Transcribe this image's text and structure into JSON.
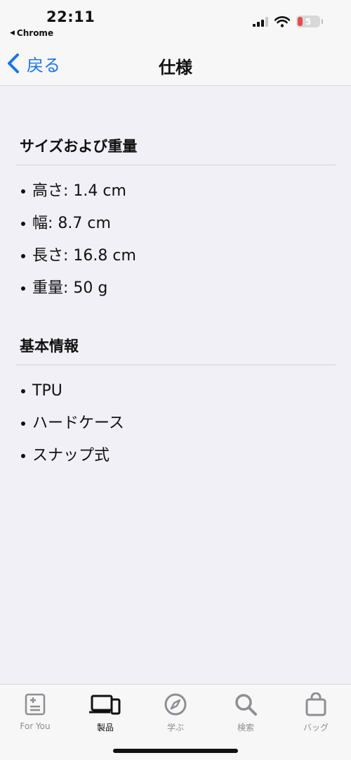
{
  "status": {
    "time": "22:11",
    "back_app": "Chrome",
    "battery": "5"
  },
  "nav": {
    "back_label": "戻る",
    "title": "仕様"
  },
  "sections": [
    {
      "title": "サイズおよび重量",
      "items": [
        "高さ: 1.4 cm",
        "幅: 8.7 cm",
        "長さ: 16.8 cm",
        "重量: 50 g"
      ]
    },
    {
      "title": "基本情報",
      "items": [
        "TPU",
        "ハードケース",
        "スナップ式"
      ]
    }
  ],
  "tabs": [
    {
      "label": "For You",
      "icon": "for-you-icon",
      "active": false
    },
    {
      "label": "製品",
      "icon": "devices-icon",
      "active": true
    },
    {
      "label": "学ぶ",
      "icon": "compass-icon",
      "active": false
    },
    {
      "label": "検索",
      "icon": "search-icon",
      "active": false
    },
    {
      "label": "バッグ",
      "icon": "bag-icon",
      "active": false
    }
  ],
  "colors": {
    "accent": "#1a73e8",
    "background": "#f1f0f6",
    "battery_low": "#e84b4b"
  }
}
